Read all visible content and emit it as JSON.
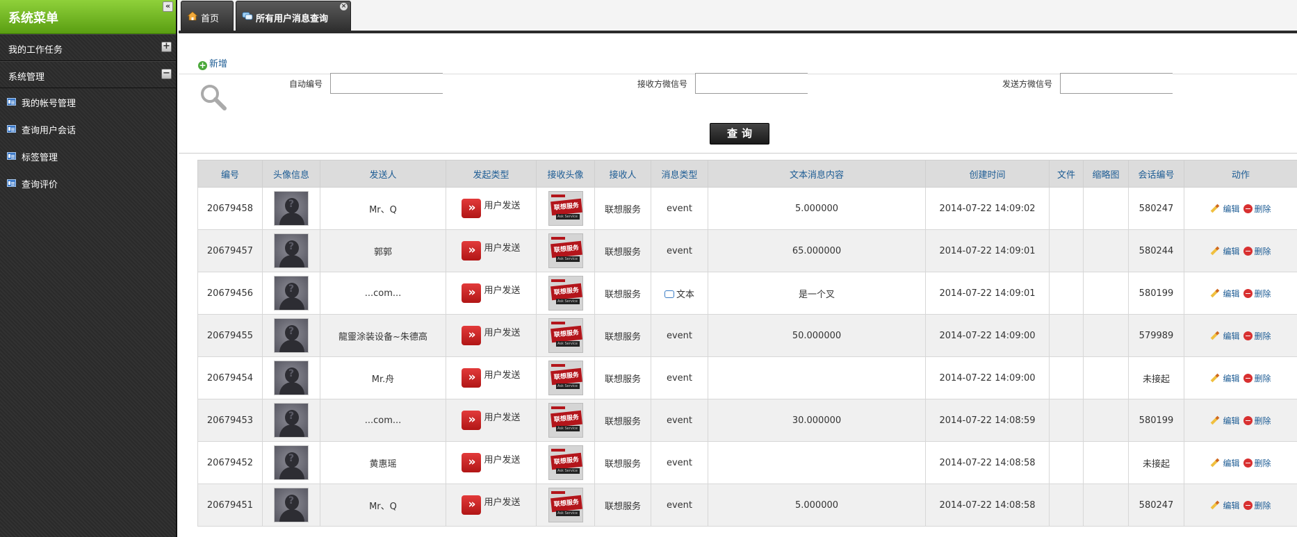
{
  "sidebar": {
    "title": "系统菜单",
    "collapse_glyph": "«",
    "sections": [
      {
        "label": "我的工作任务",
        "toggle": "+"
      },
      {
        "label": "系统管理",
        "toggle": "−"
      }
    ],
    "items": [
      {
        "label": "我的帐号管理"
      },
      {
        "label": "查询用户会话"
      },
      {
        "label": "标签管理"
      },
      {
        "label": "查询评价"
      }
    ]
  },
  "tabs": {
    "home_label": "首页",
    "active_label": "所有用户消息查询",
    "close_glyph": "×"
  },
  "toolbar": {
    "add_label": "新增",
    "add_glyph": "+"
  },
  "search": {
    "field1_label": "自动编号",
    "field1_value": "",
    "field2_label": "接收方微信号",
    "field2_value": "",
    "field3_label": "发送方微信号",
    "field3_value": "",
    "query_label": "查询"
  },
  "table": {
    "headers": [
      "编号",
      "头像信息",
      "发送人",
      "发起类型",
      "接收头像",
      "接收人",
      "消息类型",
      "文本消息内容",
      "创建时间",
      "文件",
      "缩略图",
      "会话编号",
      "动作"
    ],
    "avatar_glyph": "?",
    "send_icon_glyph": "»",
    "recv_banner": "联想服务",
    "recv_sub": "Ask Service",
    "edit_label": "编辑",
    "delete_label": "删除",
    "rows": [
      {
        "id": "20679458",
        "sender": "Mr、Q",
        "send_type": "用户发送",
        "receiver": "联想服务",
        "msg_type": "event",
        "msg_is_text": false,
        "content": "5.000000",
        "created": "2014-07-22 14:09:02",
        "file": "",
        "thumb": "",
        "session": "580247"
      },
      {
        "id": "20679457",
        "sender": "郭郭",
        "send_type": "用户发送",
        "receiver": "联想服务",
        "msg_type": "event",
        "msg_is_text": false,
        "content": "65.000000",
        "created": "2014-07-22 14:09:01",
        "file": "",
        "thumb": "",
        "session": "580244"
      },
      {
        "id": "20679456",
        "sender": "...com...",
        "send_type": "用户发送",
        "receiver": "联想服务",
        "msg_type": "文本",
        "msg_is_text": true,
        "content": "是一个叉",
        "created": "2014-07-22 14:09:01",
        "file": "",
        "thumb": "",
        "session": "580199"
      },
      {
        "id": "20679455",
        "sender": "龍靈涂装设备~朱德高",
        "send_type": "用户发送",
        "receiver": "联想服务",
        "msg_type": "event",
        "msg_is_text": false,
        "content": "50.000000",
        "created": "2014-07-22 14:09:00",
        "file": "",
        "thumb": "",
        "session": "579989"
      },
      {
        "id": "20679454",
        "sender": "Mr.舟",
        "send_type": "用户发送",
        "receiver": "联想服务",
        "msg_type": "event",
        "msg_is_text": false,
        "content": "",
        "created": "2014-07-22 14:09:00",
        "file": "",
        "thumb": "",
        "session": "未接起"
      },
      {
        "id": "20679453",
        "sender": "...com...",
        "send_type": "用户发送",
        "receiver": "联想服务",
        "msg_type": "event",
        "msg_is_text": false,
        "content": "30.000000",
        "created": "2014-07-22 14:08:59",
        "file": "",
        "thumb": "",
        "session": "580199"
      },
      {
        "id": "20679452",
        "sender": "黄惠瑶",
        "send_type": "用户发送",
        "receiver": "联想服务",
        "msg_type": "event",
        "msg_is_text": false,
        "content": "",
        "created": "2014-07-22 14:08:58",
        "file": "",
        "thumb": "",
        "session": "未接起"
      },
      {
        "id": "20679451",
        "sender": "Mr、Q",
        "send_type": "用户发送",
        "receiver": "联想服务",
        "msg_type": "event",
        "msg_is_text": false,
        "content": "5.000000",
        "created": "2014-07-22 14:08:58",
        "file": "",
        "thumb": "",
        "session": "580247"
      }
    ]
  }
}
